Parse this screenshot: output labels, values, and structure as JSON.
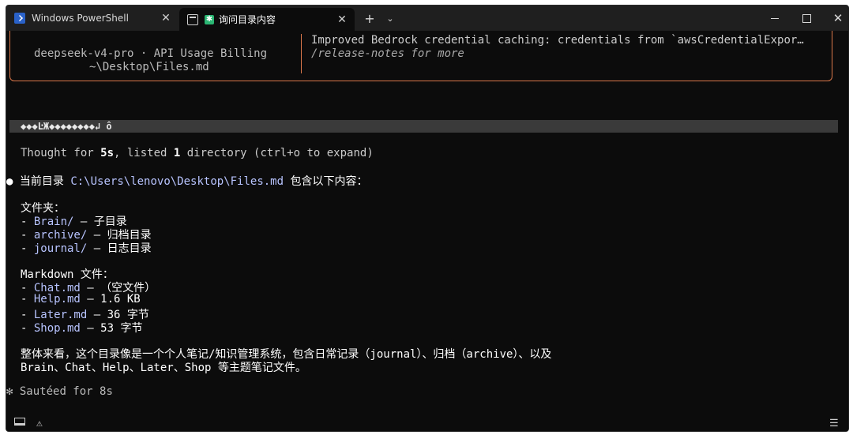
{
  "tabs": [
    {
      "label": "Windows PowerShell",
      "icon": "powershell-icon"
    },
    {
      "label": "询问目录内容",
      "icon": "sparkle-icon"
    }
  ],
  "titlebar": {
    "new_tab": "+",
    "dropdown": "⌄",
    "close_glyph": "✕"
  },
  "banner": {
    "model": "deepseek-v4-pro · API Usage Billing",
    "path": "~\\Desktop\\Files.md",
    "notes_line1": "Improved Bedrock credential caching: credentials from `awsCredentialExpor…",
    "notes_line2": "/release-notes for more"
  },
  "input_bar": "◆◆◆ĿЖ◆◆◆◆◆◆◆◆↲ ô",
  "thought": {
    "prefix": "Thought for ",
    "time": "5s",
    "mid": ", listed ",
    "count": "1",
    "suffix": " directory (ctrl+o to expand)"
  },
  "answer": {
    "bullet": "●",
    "intro_prefix": "当前目录 ",
    "intro_path": "C:\\Users\\lenovo\\Desktop\\Files.md",
    "intro_suffix": " 包含以下内容：",
    "folders_title": "文件夹：",
    "folders": [
      {
        "name": "Brain/",
        "desc": " – 子目录"
      },
      {
        "name": "archive/",
        "desc": " – 归档目录"
      },
      {
        "name": "journal/",
        "desc": " – 日志目录"
      }
    ],
    "md_title": "Markdown 文件：",
    "md_files": [
      {
        "name": "Chat.md",
        "desc": " – （空文件）"
      },
      {
        "name": "Help.md",
        "desc": " – 1.6 KB"
      },
      {
        "name": "Later.md",
        "desc": " – 36 字节"
      },
      {
        "name": "Shop.md",
        "desc": " – 53 字节"
      }
    ],
    "dash": "- ",
    "summary_line1": "整体来看，这个目录像是一个个人笔记/知识管理系统，包含日常记录（journal）、归档（archive）、以及",
    "summary_line2": "Brain、Chat、Help、Later、Shop 等主题笔记文件。"
  },
  "sauteed": {
    "icon": "✻",
    "text": " Sautéed for 8s"
  },
  "status": {
    "menu_glyph": "☰",
    "warn_glyph": "⚠"
  }
}
